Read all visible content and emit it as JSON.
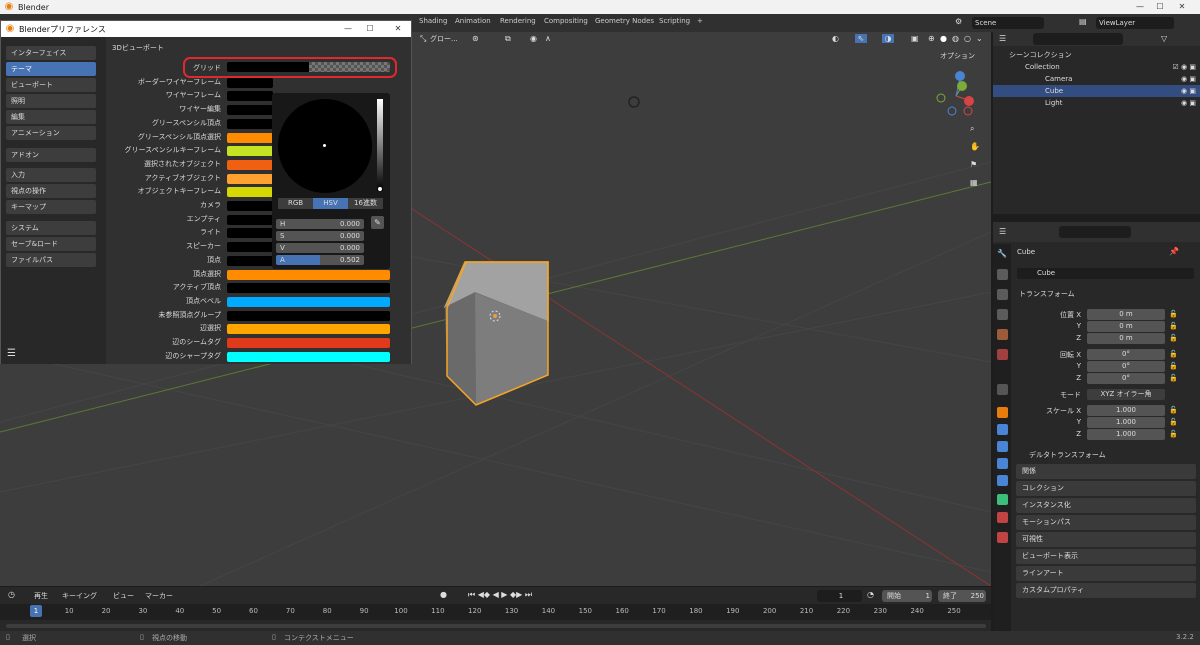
{
  "window": {
    "title": "Blender",
    "min": "—",
    "max": "☐",
    "close": "✕"
  },
  "topbar": {
    "tabs": [
      "Shading",
      "Animation",
      "Rendering",
      "Compositing",
      "Geometry Nodes",
      "Scripting",
      "+"
    ],
    "scene": "Scene",
    "view_layer": "ViewLayer"
  },
  "viewport": {
    "transform_orient": "グロー...",
    "options": "オプション"
  },
  "prefs": {
    "title": "Blenderプリファレンス",
    "nav": [
      "インターフェイス",
      "テーマ",
      "ビューポート",
      "照明",
      "編集",
      "アニメーション",
      "アドオン",
      "入力",
      "視点の操作",
      "キーマップ",
      "システム",
      "セーブ&ロード",
      "ファイルパス"
    ],
    "section": "3Dビューポート",
    "rows": [
      "グリッド",
      "ボーダーワイヤーフレーム",
      "ワイヤーフレーム",
      "ワイヤー編集",
      "グリースペンシル頂点",
      "グリースペンシル頂点選択",
      "グリースペンシルキーフレーム",
      "選択されたオブジェクト",
      "アクティブオブジェクト",
      "オブジェクトキーフレーム",
      "カメラ",
      "エンプティ",
      "ライト",
      "スピーカー",
      "頂点",
      "頂点選択",
      "アクティブ頂点",
      "頂点ベベル",
      "未参照頂点グループ",
      "辺選択",
      "辺のシームタグ",
      "辺のシャープタグ"
    ],
    "picker": {
      "modes": [
        "RGB",
        "HSV",
        "16進数"
      ],
      "active_mode": "HSV",
      "fields": [
        {
          "label": "H",
          "value": "0.000"
        },
        {
          "label": "S",
          "value": "0.000"
        },
        {
          "label": "V",
          "value": "0.000"
        },
        {
          "label": "A",
          "value": "0.502"
        }
      ]
    }
  },
  "outliner": {
    "root": "シーンコレクション",
    "items": [
      "Collection",
      "Camera",
      "Cube",
      "Light"
    ]
  },
  "properties": {
    "object": "Cube",
    "data_name": "Cube",
    "transform": "トランスフォーム",
    "location_label": "位置 X",
    "rotation_label": "回転 X",
    "scale_label": "スケール X",
    "axes": [
      "Y",
      "Z"
    ],
    "location": [
      "0 m",
      "0 m",
      "0 m"
    ],
    "rotation": [
      "0°",
      "0°",
      "0°"
    ],
    "scale": [
      "1.000",
      "1.000",
      "1.000"
    ],
    "mode_label": "モード",
    "mode": "XYZ オイラー角",
    "panels": [
      "デルタトランスフォーム",
      "関係",
      "コレクション",
      "インスタンス化",
      "モーションパス",
      "可視性",
      "ビューポート表示",
      "ラインアート",
      "カスタムプロパティ"
    ]
  },
  "timeline": {
    "menus": [
      "再生",
      "キーイング",
      "ビュー",
      "マーカー"
    ],
    "current": "1",
    "start_label": "開始",
    "start": "1",
    "end_label": "終了",
    "end": "250",
    "ticks": [
      "1",
      "10",
      "20",
      "30",
      "40",
      "50",
      "60",
      "70",
      "80",
      "90",
      "100",
      "110",
      "120",
      "130",
      "140",
      "150",
      "160",
      "170",
      "180",
      "190",
      "200",
      "210",
      "220",
      "230",
      "240",
      "250"
    ]
  },
  "status": {
    "select": "選択",
    "move": "視点の移動",
    "context": "コンテクストメニュー",
    "version": "3.2.2"
  },
  "colors": {
    "accent": "#4772b3",
    "highlight": "#e0282f",
    "orange": "#ff8c00",
    "cyan": "#00ffff"
  }
}
